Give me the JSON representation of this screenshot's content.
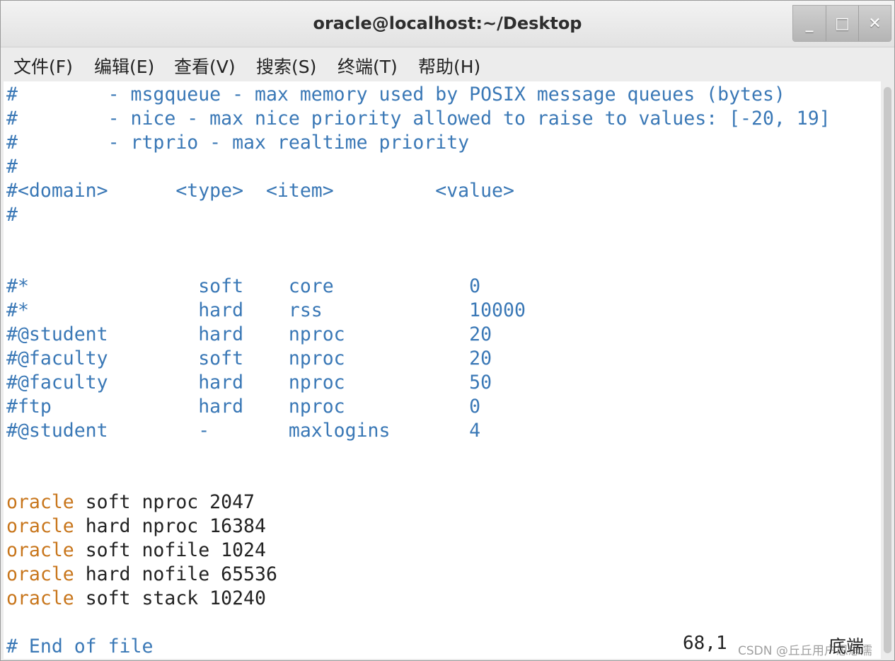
{
  "window": {
    "title": "oracle@localhost:~/Desktop",
    "controls": {
      "minimize": "_",
      "maximize": "□",
      "close": "✕"
    }
  },
  "menu": [
    "文件(F)",
    "编辑(E)",
    "查看(V)",
    "搜索(S)",
    "终端(T)",
    "帮助(H)"
  ],
  "lines": [
    {
      "type": "comment",
      "text": "#        - msgqueue - max memory used by POSIX message queues (bytes)"
    },
    {
      "type": "comment",
      "text": "#        - nice - max nice priority allowed to raise to values: [-20, 19]"
    },
    {
      "type": "comment",
      "text": "#        - rtprio - max realtime priority"
    },
    {
      "type": "comment",
      "text": "#"
    },
    {
      "type": "comment",
      "text": "#<domain>      <type>  <item>         <value>"
    },
    {
      "type": "comment",
      "text": "#"
    },
    {
      "type": "blank",
      "text": ""
    },
    {
      "type": "blank",
      "text": ""
    },
    {
      "type": "comment",
      "text": "#*               soft    core            0"
    },
    {
      "type": "comment",
      "text": "#*               hard    rss             10000"
    },
    {
      "type": "comment",
      "text": "#@student        hard    nproc           20"
    },
    {
      "type": "comment",
      "text": "#@faculty        soft    nproc           20"
    },
    {
      "type": "comment",
      "text": "#@faculty        hard    nproc           50"
    },
    {
      "type": "comment",
      "text": "#ftp             hard    nproc           0"
    },
    {
      "type": "comment",
      "text": "#@student        -       maxlogins       4"
    },
    {
      "type": "blank",
      "text": ""
    },
    {
      "type": "blank",
      "text": ""
    },
    {
      "type": "entry",
      "user": "oracle",
      "rest": " soft nproc 2047"
    },
    {
      "type": "entry",
      "user": "oracle",
      "rest": " hard nproc 16384"
    },
    {
      "type": "entry",
      "user": "oracle",
      "rest": " soft nofile 1024"
    },
    {
      "type": "entry",
      "user": "oracle",
      "rest": " hard nofile 65536"
    },
    {
      "type": "entry",
      "user": "oracle",
      "rest": " soft stack 10240"
    },
    {
      "type": "blank",
      "text": ""
    },
    {
      "type": "comment",
      "text": "# End of file"
    }
  ],
  "status": {
    "position": "68,1",
    "scroll": "底端"
  },
  "watermark": "CSDN @丘丘用户思思濡",
  "colors": {
    "comment": "#3a78b6",
    "keyword": "#c8761c",
    "text": "#222222"
  }
}
